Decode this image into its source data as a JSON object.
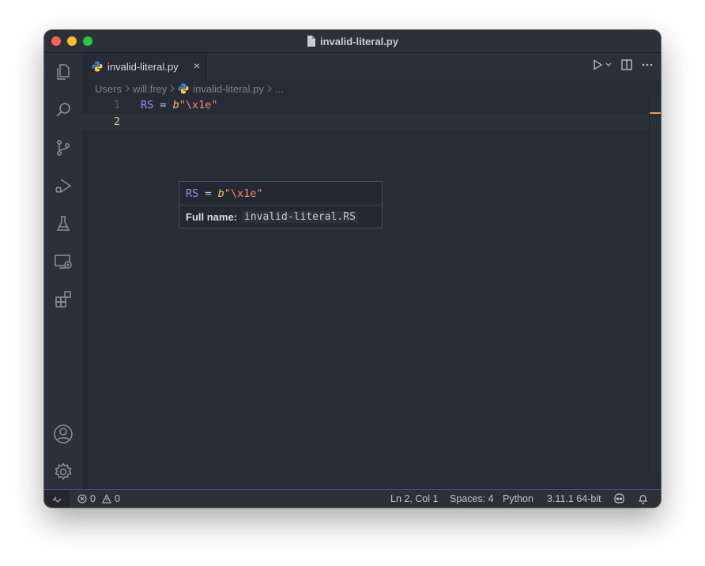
{
  "window": {
    "title": "invalid-literal.py"
  },
  "tab": {
    "label": "invalid-literal.py",
    "close_glyph": "×"
  },
  "breadcrumbs": [
    "Users",
    "will.frey",
    "invalid-literal.py",
    "..."
  ],
  "editor": {
    "lines": [
      {
        "number": "1",
        "tokens": {
          "var": "RS",
          "op": " = ",
          "prefix": "b",
          "str": "\"\\x1e\""
        }
      },
      {
        "number": "2",
        "tokens": {}
      }
    ]
  },
  "hover": {
    "signature": {
      "var": "RS",
      "op": " = ",
      "prefix": "b",
      "str": "\"\\x1e\""
    },
    "full_name_label": "Full name:",
    "full_name_value": "invalid-literal.RS"
  },
  "status": {
    "errors": "0",
    "warnings": "0",
    "position": "Ln 2, Col 1",
    "spaces": "Spaces: 4",
    "language": "Python",
    "interpreter": "3.11.1 64-bit"
  },
  "icons": {
    "activity": [
      "explorer-icon",
      "search-icon",
      "source-control-icon",
      "run-debug-icon",
      "testing-icon",
      "remote-explorer-icon",
      "extensions-icon",
      "account-icon",
      "settings-gear-icon"
    ]
  },
  "colors": {
    "accent": "#5b52a8",
    "current_line_number": "#e5c07b",
    "keyword_var": "#9d8df1",
    "string": "#ef8b7b"
  }
}
